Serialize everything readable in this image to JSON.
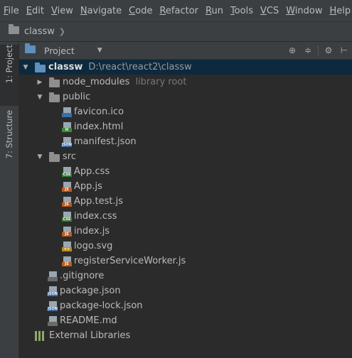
{
  "menubar": {
    "items": [
      {
        "mn": "F",
        "rest": "ile"
      },
      {
        "mn": "E",
        "rest": "dit"
      },
      {
        "mn": "V",
        "rest": "iew"
      },
      {
        "mn": "N",
        "rest": "avigate"
      },
      {
        "mn": "C",
        "rest": "ode"
      },
      {
        "mn": "R",
        "rest": "efactor"
      },
      {
        "mn": "R",
        "rest": "un"
      },
      {
        "mn": "T",
        "rest": "ools"
      },
      {
        "mn": "V",
        "rest": "CS"
      },
      {
        "mn": "W",
        "rest": "indow"
      },
      {
        "mn": "H",
        "rest": "elp"
      }
    ]
  },
  "navbar": {
    "project_name": "classw"
  },
  "left_strip": {
    "project_tab": "1: Project",
    "structure_tab": "7: Structure"
  },
  "tool_window": {
    "view_label": "Project"
  },
  "tree": {
    "root": {
      "name": "classw",
      "path": "D:\\react\\react2\\classw"
    },
    "node_modules": {
      "name": "node_modules",
      "hint": "library root"
    },
    "public": {
      "name": "public",
      "files": [
        "favicon.ico",
        "index.html",
        "manifest.json"
      ]
    },
    "src": {
      "name": "src",
      "files": [
        "App.css",
        "App.js",
        "App.test.js",
        "index.css",
        "index.js",
        "logo.svg",
        "registerServiceWorker.js"
      ]
    },
    "root_files": [
      ".gitignore",
      "package.json",
      "package-lock.json",
      "README.md"
    ],
    "external_libraries": "External Libraries"
  },
  "colors": {
    "selection": "#0d293e",
    "folder_blue": "#5f8fbf",
    "background": "#2b2b2b",
    "panel": "#3c3f41"
  }
}
